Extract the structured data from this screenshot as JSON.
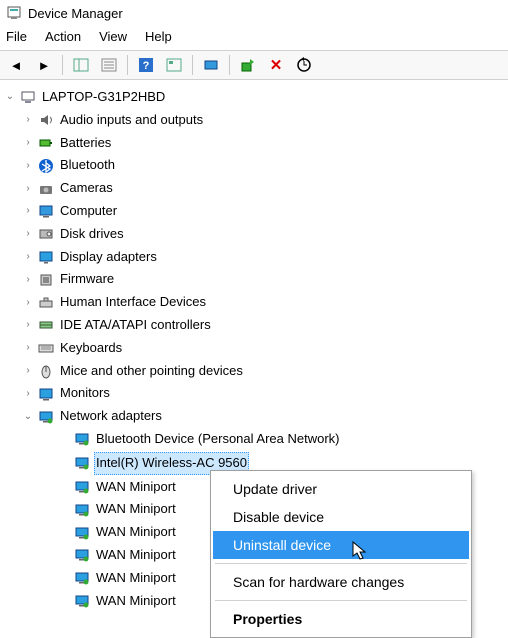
{
  "window": {
    "title": "Device Manager"
  },
  "menubar": [
    "File",
    "Action",
    "View",
    "Help"
  ],
  "toolbar_icons": [
    "back-icon",
    "forward-icon",
    "sep",
    "show-hide-tree-icon",
    "properties-list-icon",
    "sep",
    "help-icon",
    "action-details-icon",
    "sep",
    "show-hidden-icon",
    "sep",
    "update-driver-icon",
    "uninstall-icon",
    "scan-hardware-icon"
  ],
  "tree": {
    "root": {
      "label": "LAPTOP-G31P2HBD",
      "expander": "open",
      "indent": 0,
      "icon": "computer-icon"
    },
    "categories": [
      {
        "label": "Audio inputs and outputs",
        "expander": "closed",
        "icon": "audio-icon"
      },
      {
        "label": "Batteries",
        "expander": "closed",
        "icon": "battery-icon"
      },
      {
        "label": "Bluetooth",
        "expander": "closed",
        "icon": "bluetooth-icon"
      },
      {
        "label": "Cameras",
        "expander": "closed",
        "icon": "camera-icon"
      },
      {
        "label": "Computer",
        "expander": "closed",
        "icon": "pc-icon"
      },
      {
        "label": "Disk drives",
        "expander": "closed",
        "icon": "disk-icon"
      },
      {
        "label": "Display adapters",
        "expander": "closed",
        "icon": "display-icon"
      },
      {
        "label": "Firmware",
        "expander": "closed",
        "icon": "firmware-icon"
      },
      {
        "label": "Human Interface Devices",
        "expander": "closed",
        "icon": "hid-icon"
      },
      {
        "label": "IDE ATA/ATAPI controllers",
        "expander": "closed",
        "icon": "ide-icon"
      },
      {
        "label": "Keyboards",
        "expander": "closed",
        "icon": "keyboard-icon"
      },
      {
        "label": "Mice and other pointing devices",
        "expander": "closed",
        "icon": "mouse-icon"
      },
      {
        "label": "Monitors",
        "expander": "closed",
        "icon": "monitor-icon"
      },
      {
        "label": "Network adapters",
        "expander": "open",
        "icon": "network-icon",
        "children": [
          {
            "label": "Bluetooth Device (Personal Area Network)",
            "icon": "netadapter-icon"
          },
          {
            "label": "Intel(R) Wireless-AC 9560",
            "icon": "netadapter-icon",
            "selected": true
          },
          {
            "label": "WAN Miniport",
            "icon": "netadapter-icon"
          },
          {
            "label": "WAN Miniport",
            "icon": "netadapter-icon"
          },
          {
            "label": "WAN Miniport",
            "icon": "netadapter-icon"
          },
          {
            "label": "WAN Miniport",
            "icon": "netadapter-icon"
          },
          {
            "label": "WAN Miniport",
            "icon": "netadapter-icon"
          },
          {
            "label": "WAN Miniport",
            "icon": "netadapter-icon"
          }
        ]
      }
    ]
  },
  "context_menu": {
    "items": [
      {
        "label": "Update driver",
        "type": "item"
      },
      {
        "label": "Disable device",
        "type": "item"
      },
      {
        "label": "Uninstall device",
        "type": "item",
        "highlight": true
      },
      {
        "type": "sep"
      },
      {
        "label": "Scan for hardware changes",
        "type": "item"
      },
      {
        "type": "sep"
      },
      {
        "label": "Properties",
        "type": "item",
        "bold": true
      }
    ]
  }
}
